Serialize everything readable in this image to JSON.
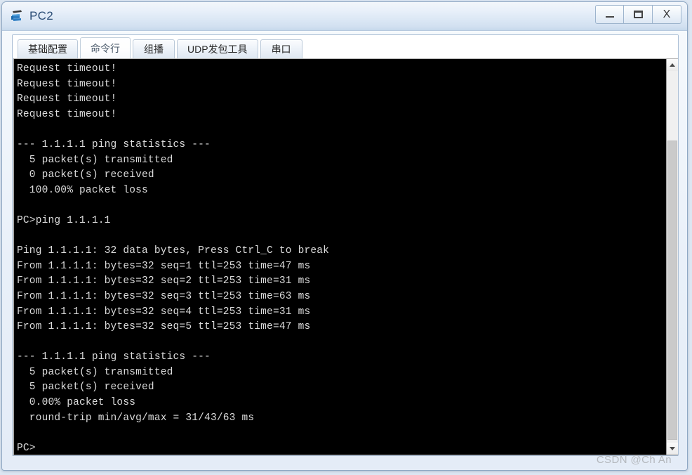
{
  "window": {
    "title": "PC2",
    "icon": "pc-computer-icon",
    "controls": {
      "minimize": "–",
      "maximize": "□",
      "close": "X"
    }
  },
  "tabs": [
    {
      "label": "基础配置",
      "active": false
    },
    {
      "label": "命令行",
      "active": true
    },
    {
      "label": "组播",
      "active": false
    },
    {
      "label": "UDP发包工具",
      "active": false
    },
    {
      "label": "串口",
      "active": false
    }
  ],
  "terminal": {
    "lines": [
      "Request timeout!",
      "Request timeout!",
      "Request timeout!",
      "Request timeout!",
      "",
      "--- 1.1.1.1 ping statistics ---",
      "  5 packet(s) transmitted",
      "  0 packet(s) received",
      "  100.00% packet loss",
      "",
      "PC>ping 1.1.1.1",
      "",
      "Ping 1.1.1.1: 32 data bytes, Press Ctrl_C to break",
      "From 1.1.1.1: bytes=32 seq=1 ttl=253 time=47 ms",
      "From 1.1.1.1: bytes=32 seq=2 ttl=253 time=31 ms",
      "From 1.1.1.1: bytes=32 seq=3 ttl=253 time=63 ms",
      "From 1.1.1.1: bytes=32 seq=4 ttl=253 time=31 ms",
      "From 1.1.1.1: bytes=32 seq=5 ttl=253 time=47 ms",
      "",
      "--- 1.1.1.1 ping statistics ---",
      "  5 packet(s) transmitted",
      "  5 packet(s) received",
      "  0.00% packet loss",
      "  round-trip min/avg/max = 31/43/63 ms",
      "",
      "PC>"
    ],
    "background_color": "#000000",
    "text_color": "#dcdcdc"
  },
  "scrollbar": {
    "up_arrow": "▲",
    "down_arrow": "▼"
  },
  "watermark": {
    "text": "CSDN @Ch An"
  }
}
